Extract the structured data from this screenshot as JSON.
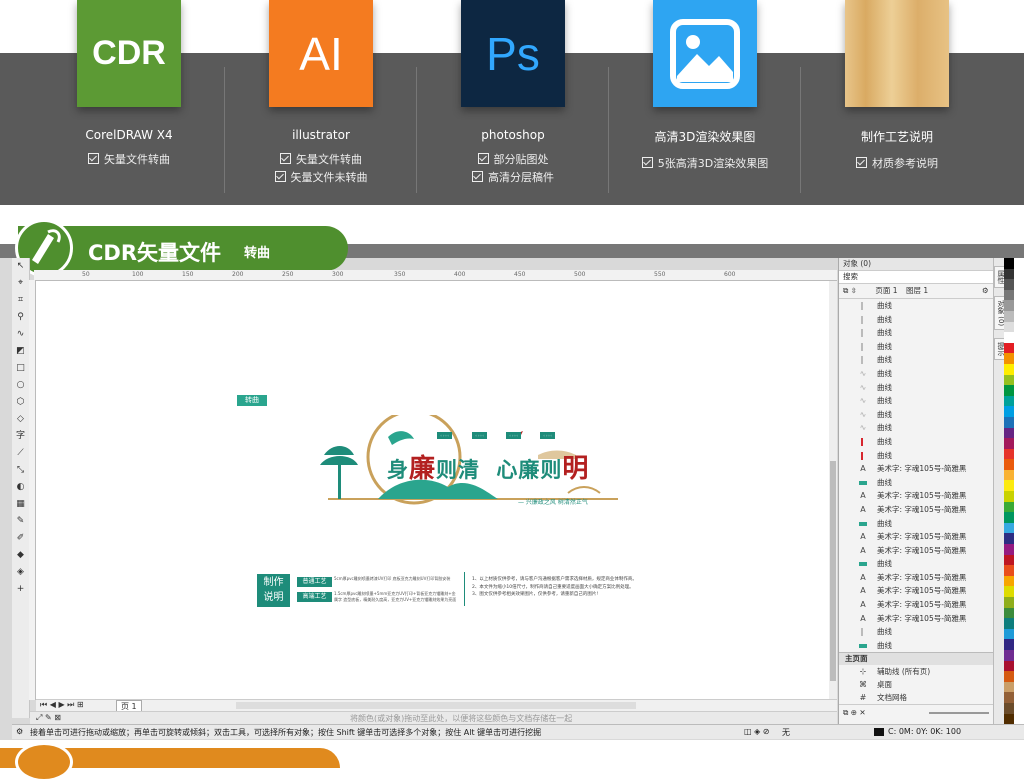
{
  "features": [
    {
      "tile": "CDR",
      "title": "CorelDRAW X4",
      "checks": [
        "矢量文件转曲"
      ],
      "color": "#5c9a34"
    },
    {
      "tile": "AI",
      "title": "illustrator",
      "checks": [
        "矢量文件转曲",
        "矢量文件未转曲"
      ],
      "color": "#f47b20"
    },
    {
      "tile": "Ps",
      "title": "photoshop",
      "checks": [
        "部分贴图处",
        "高清分层稿件"
      ],
      "color": "#0d2742"
    },
    {
      "tile": "image-icon",
      "title": "高清3D渲染效果图",
      "checks": [
        "5张高清3D渲染效果图"
      ],
      "color": "#2ea5f2"
    },
    {
      "tile": "wood-texture",
      "title": "制作工艺说明",
      "checks": [
        "材质参考说明"
      ],
      "color": "#e3bd7c"
    }
  ],
  "section": {
    "title": "CDR矢量文件",
    "subtitle": "转曲"
  },
  "canvas": {
    "tag": "转曲",
    "design_title_a": "身",
    "design_title_b": "廉",
    "design_title_c": "则清",
    "design_title_d": "心廉则",
    "design_title_e": "明",
    "slogan": "— 兴廉政之风  树清然正气",
    "info_box": "制作\n说明",
    "btn_normal": "普通工艺",
    "btn_high": "高端工艺",
    "normal_text": "5cm厚pvc雕刻喷墨烤漆UV打印 底板亚克力雕刻UV打印背胶安装",
    "high_text": "1.5cm厚pvc雕刻喷墨+5mm亚克力UV打印+背板亚克力镭雕刻+金属字 造型底板，精美耐久度高，亚克力UV+亚克力镭雕刻效果为亮面",
    "note1": "1、以上材质仅供参考，请与客户沟通根据客户需求选择材质，规定商业体制作商。",
    "note2": "2、本文件为缩小10倍尺寸，制作商请自己重要适度画面大小确定方案比例处理。",
    "note3": "3、图文仅供参考相关效果图片，仅供参考，请重新自己的图片!"
  },
  "page_tab": "页 1",
  "colorbar_hint": "将颜色(或对象)拖动至此处，以便将这些颜色与文档存储在一起",
  "status_text": "接着单击可进行拖动或缩放；再单击可旋转或倾斜；双击工具，可选择所有对象；按住 Shift 键单击可选择多个对象；按住 Alt 键单击可进行挖掘",
  "status_right": "无",
  "status_cmyk": "C: 0M: 0Y: 0K: 100",
  "ruler_ticks": [
    "50",
    "100",
    "150",
    "200",
    "250",
    "300",
    "350",
    "400",
    "450",
    "500",
    "550",
    "600"
  ],
  "panel": {
    "header": "对象 (0)",
    "search": "搜索",
    "page": "页面 1",
    "layer": "图层 1",
    "objects": [
      {
        "icon": "bar",
        "label": "曲线"
      },
      {
        "icon": "bar",
        "label": "曲线"
      },
      {
        "icon": "bar",
        "label": "曲线"
      },
      {
        "icon": "bar",
        "label": "曲线"
      },
      {
        "icon": "bar",
        "label": "曲线"
      },
      {
        "icon": "glyph",
        "label": "曲线"
      },
      {
        "icon": "glyph",
        "label": "曲线"
      },
      {
        "icon": "glyph",
        "label": "曲线"
      },
      {
        "icon": "glyph",
        "label": "曲线"
      },
      {
        "icon": "glyph",
        "label": "曲线"
      },
      {
        "icon": "redbar",
        "label": "曲线"
      },
      {
        "icon": "redbar",
        "label": "曲线"
      },
      {
        "icon": "A",
        "label": "美术字: 字魂105号-简雅黑"
      },
      {
        "icon": "sq",
        "label": "曲线"
      },
      {
        "icon": "A",
        "label": "美术字: 字魂105号-简雅黑"
      },
      {
        "icon": "A",
        "label": "美术字: 字魂105号-简雅黑"
      },
      {
        "icon": "sq",
        "label": "曲线"
      },
      {
        "icon": "A",
        "label": "美术字: 字魂105号-简雅黑"
      },
      {
        "icon": "A",
        "label": "美术字: 字魂105号-简雅黑"
      },
      {
        "icon": "sq",
        "label": "曲线"
      },
      {
        "icon": "A",
        "label": "美术字: 字魂105号-简雅黑"
      },
      {
        "icon": "A",
        "label": "美术字: 字魂105号-简雅黑"
      },
      {
        "icon": "A",
        "label": "美术字: 字魂105号-简雅黑"
      },
      {
        "icon": "A",
        "label": "美术字: 字魂105号-简雅黑"
      },
      {
        "icon": "bar",
        "label": "曲线"
      },
      {
        "icon": "sq",
        "label": "曲线"
      }
    ],
    "master_head": "主页面",
    "master_rows": [
      "辅助线 (所有页)",
      "桌面",
      "文档网格"
    ],
    "tabs": [
      "属性",
      "对象 (0)",
      "提示"
    ]
  },
  "palette": [
    "#000000",
    "#333333",
    "#555555",
    "#777777",
    "#999999",
    "#bbbbbb",
    "#dddddd",
    "#ffffff",
    "#e31e24",
    "#f39200",
    "#ffed00",
    "#95c11f",
    "#009640",
    "#00a19a",
    "#009fe3",
    "#1d71b8",
    "#662483",
    "#a3195b",
    "#e6332a",
    "#ea5b0c",
    "#f9b233",
    "#fcea10",
    "#c9d200",
    "#3aaa35",
    "#00975f",
    "#36a9e1",
    "#2d2e83",
    "#951b81",
    "#be1622",
    "#e94e1b",
    "#f7a600",
    "#dedc00",
    "#8fae1b",
    "#3c8c3c",
    "#0e7e7d",
    "#1f9bd8",
    "#312783",
    "#6f2c91",
    "#a90f2f",
    "#d55a11",
    "#ca9e67",
    "#936037",
    "#6b4c2a",
    "#512d00"
  ]
}
